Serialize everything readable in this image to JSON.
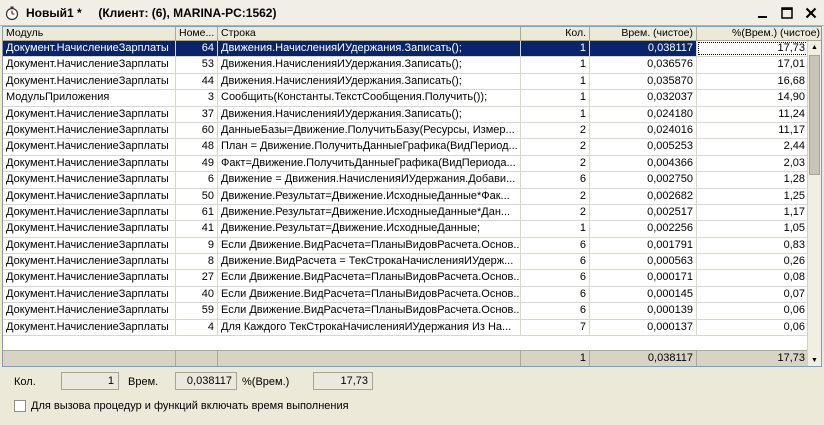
{
  "window": {
    "title": "Новый1 *     (Клиент: (6), MARINA-PC:1562)"
  },
  "table": {
    "columns": [
      "Модуль",
      "Номе...",
      "Строка",
      "Кол.",
      "Врем. (чистое)",
      "%(Врем.) (чистое)"
    ],
    "rows": [
      {
        "module": "Документ.НачислениеЗарплаты",
        "line": "64",
        "code": "Движения.НачисленияИУдержания.Записать();",
        "count": "1",
        "time": "0,038117",
        "pct": "17,73",
        "selected": true
      },
      {
        "module": "Документ.НачислениеЗарплаты",
        "line": "53",
        "code": "Движения.НачисленияИУдержания.Записать();",
        "count": "1",
        "time": "0,036576",
        "pct": "17,01"
      },
      {
        "module": "Документ.НачислениеЗарплаты",
        "line": "44",
        "code": "Движения.НачисленияИУдержания.Записать();",
        "count": "1",
        "time": "0,035870",
        "pct": "16,68"
      },
      {
        "module": "МодульПриложения",
        "line": "3",
        "code": "Сообщить(Константы.ТекстСообщения.Получить());",
        "count": "1",
        "time": "0,032037",
        "pct": "14,90"
      },
      {
        "module": "Документ.НачислениеЗарплаты",
        "line": "37",
        "code": "Движения.НачисленияИУдержания.Записать();",
        "count": "1",
        "time": "0,024180",
        "pct": "11,24"
      },
      {
        "module": "Документ.НачислениеЗарплаты",
        "line": "60",
        "code": "ДанныеБазы=Движение.ПолучитьБазу(Ресурсы, Измер...",
        "count": "2",
        "time": "0,024016",
        "pct": "11,17"
      },
      {
        "module": "Документ.НачислениеЗарплаты",
        "line": "48",
        "code": "План = Движение.ПолучитьДанныеГрафика(ВидПериод...",
        "count": "2",
        "time": "0,005253",
        "pct": "2,44"
      },
      {
        "module": "Документ.НачислениеЗарплаты",
        "line": "49",
        "code": "Факт=Движение.ПолучитьДанныеГрафика(ВидПериода...",
        "count": "2",
        "time": "0,004366",
        "pct": "2,03"
      },
      {
        "module": "Документ.НачислениеЗарплаты",
        "line": "6",
        "code": "Движение = Движения.НачисленияИУдержания.Добави...",
        "count": "6",
        "time": "0,002750",
        "pct": "1,28"
      },
      {
        "module": "Документ.НачислениеЗарплаты",
        "line": "50",
        "code": "Движение.Результат=Движение.ИсходныеДанные*Фак...",
        "count": "2",
        "time": "0,002682",
        "pct": "1,25"
      },
      {
        "module": "Документ.НачислениеЗарплаты",
        "line": "61",
        "code": "Движение.Результат=Движение.ИсходныеДанные*Дан...",
        "count": "2",
        "time": "0,002517",
        "pct": "1,17"
      },
      {
        "module": "Документ.НачислениеЗарплаты",
        "line": "41",
        "code": "Движение.Результат=Движение.ИсходныеДанные;",
        "count": "1",
        "time": "0,002256",
        "pct": "1,05"
      },
      {
        "module": "Документ.НачислениеЗарплаты",
        "line": "9",
        "code": "Если Движение.ВидРасчета=ПланыВидовРасчета.Основ...",
        "count": "6",
        "time": "0,001791",
        "pct": "0,83"
      },
      {
        "module": "Документ.НачислениеЗарплаты",
        "line": "8",
        "code": "Движение.ВидРасчета = ТекСтрокаНачисленияИУдерж...",
        "count": "6",
        "time": "0,000563",
        "pct": "0,26"
      },
      {
        "module": "Документ.НачислениеЗарплаты",
        "line": "27",
        "code": "Если Движение.ВидРасчета=ПланыВидовРасчета.Основ...",
        "count": "6",
        "time": "0,000171",
        "pct": "0,08"
      },
      {
        "module": "Документ.НачислениеЗарплаты",
        "line": "40",
        "code": "Если Движение.ВидРасчета=ПланыВидовРасчета.Основ...",
        "count": "6",
        "time": "0,000145",
        "pct": "0,07"
      },
      {
        "module": "Документ.НачислениеЗарплаты",
        "line": "59",
        "code": "Если Движение.ВидРасчета=ПланыВидовРасчета.Основ...",
        "count": "6",
        "time": "0,000139",
        "pct": "0,06"
      },
      {
        "module": "Документ.НачислениеЗарплаты",
        "line": "4",
        "code": "Для Каждого ТекСтрокаНачисленияИУдержания Из На...",
        "count": "7",
        "time": "0,000137",
        "pct": "0,06"
      }
    ],
    "totals": {
      "count": "1",
      "time": "0,038117",
      "pct": "17,73"
    }
  },
  "footer": {
    "count_label": "Кол.",
    "count_value": "1",
    "time_label": "Врем.",
    "time_value": "0,038117",
    "pct_label": "%(Врем.)",
    "pct_value": "17,73",
    "checkbox_label": "Для вызова процедур и функций включать время выполнения"
  },
  "colors": {
    "selection": "#0a246a",
    "window_bg": "#ece9d8"
  },
  "icons": [
    "stopwatch-icon",
    "minimize-icon",
    "maximize-icon",
    "close-icon",
    "scroll-up-icon",
    "scroll-down-icon"
  ]
}
